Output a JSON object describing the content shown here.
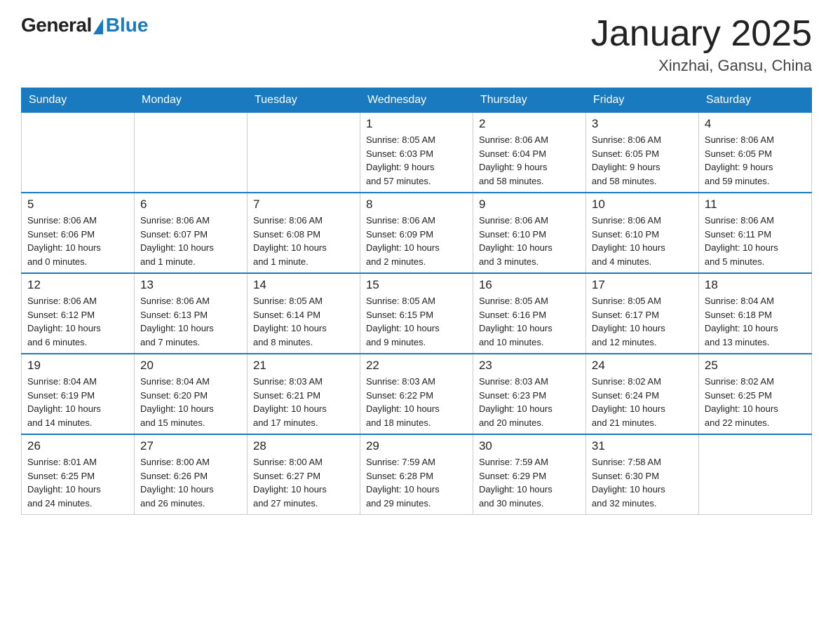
{
  "logo": {
    "general": "General",
    "blue": "Blue"
  },
  "title": "January 2025",
  "subtitle": "Xinzhai, Gansu, China",
  "days_of_week": [
    "Sunday",
    "Monday",
    "Tuesday",
    "Wednesday",
    "Thursday",
    "Friday",
    "Saturday"
  ],
  "weeks": [
    [
      {
        "day": "",
        "info": ""
      },
      {
        "day": "",
        "info": ""
      },
      {
        "day": "",
        "info": ""
      },
      {
        "day": "1",
        "info": "Sunrise: 8:05 AM\nSunset: 6:03 PM\nDaylight: 9 hours\nand 57 minutes."
      },
      {
        "day": "2",
        "info": "Sunrise: 8:06 AM\nSunset: 6:04 PM\nDaylight: 9 hours\nand 58 minutes."
      },
      {
        "day": "3",
        "info": "Sunrise: 8:06 AM\nSunset: 6:05 PM\nDaylight: 9 hours\nand 58 minutes."
      },
      {
        "day": "4",
        "info": "Sunrise: 8:06 AM\nSunset: 6:05 PM\nDaylight: 9 hours\nand 59 minutes."
      }
    ],
    [
      {
        "day": "5",
        "info": "Sunrise: 8:06 AM\nSunset: 6:06 PM\nDaylight: 10 hours\nand 0 minutes."
      },
      {
        "day": "6",
        "info": "Sunrise: 8:06 AM\nSunset: 6:07 PM\nDaylight: 10 hours\nand 1 minute."
      },
      {
        "day": "7",
        "info": "Sunrise: 8:06 AM\nSunset: 6:08 PM\nDaylight: 10 hours\nand 1 minute."
      },
      {
        "day": "8",
        "info": "Sunrise: 8:06 AM\nSunset: 6:09 PM\nDaylight: 10 hours\nand 2 minutes."
      },
      {
        "day": "9",
        "info": "Sunrise: 8:06 AM\nSunset: 6:10 PM\nDaylight: 10 hours\nand 3 minutes."
      },
      {
        "day": "10",
        "info": "Sunrise: 8:06 AM\nSunset: 6:10 PM\nDaylight: 10 hours\nand 4 minutes."
      },
      {
        "day": "11",
        "info": "Sunrise: 8:06 AM\nSunset: 6:11 PM\nDaylight: 10 hours\nand 5 minutes."
      }
    ],
    [
      {
        "day": "12",
        "info": "Sunrise: 8:06 AM\nSunset: 6:12 PM\nDaylight: 10 hours\nand 6 minutes."
      },
      {
        "day": "13",
        "info": "Sunrise: 8:06 AM\nSunset: 6:13 PM\nDaylight: 10 hours\nand 7 minutes."
      },
      {
        "day": "14",
        "info": "Sunrise: 8:05 AM\nSunset: 6:14 PM\nDaylight: 10 hours\nand 8 minutes."
      },
      {
        "day": "15",
        "info": "Sunrise: 8:05 AM\nSunset: 6:15 PM\nDaylight: 10 hours\nand 9 minutes."
      },
      {
        "day": "16",
        "info": "Sunrise: 8:05 AM\nSunset: 6:16 PM\nDaylight: 10 hours\nand 10 minutes."
      },
      {
        "day": "17",
        "info": "Sunrise: 8:05 AM\nSunset: 6:17 PM\nDaylight: 10 hours\nand 12 minutes."
      },
      {
        "day": "18",
        "info": "Sunrise: 8:04 AM\nSunset: 6:18 PM\nDaylight: 10 hours\nand 13 minutes."
      }
    ],
    [
      {
        "day": "19",
        "info": "Sunrise: 8:04 AM\nSunset: 6:19 PM\nDaylight: 10 hours\nand 14 minutes."
      },
      {
        "day": "20",
        "info": "Sunrise: 8:04 AM\nSunset: 6:20 PM\nDaylight: 10 hours\nand 15 minutes."
      },
      {
        "day": "21",
        "info": "Sunrise: 8:03 AM\nSunset: 6:21 PM\nDaylight: 10 hours\nand 17 minutes."
      },
      {
        "day": "22",
        "info": "Sunrise: 8:03 AM\nSunset: 6:22 PM\nDaylight: 10 hours\nand 18 minutes."
      },
      {
        "day": "23",
        "info": "Sunrise: 8:03 AM\nSunset: 6:23 PM\nDaylight: 10 hours\nand 20 minutes."
      },
      {
        "day": "24",
        "info": "Sunrise: 8:02 AM\nSunset: 6:24 PM\nDaylight: 10 hours\nand 21 minutes."
      },
      {
        "day": "25",
        "info": "Sunrise: 8:02 AM\nSunset: 6:25 PM\nDaylight: 10 hours\nand 22 minutes."
      }
    ],
    [
      {
        "day": "26",
        "info": "Sunrise: 8:01 AM\nSunset: 6:25 PM\nDaylight: 10 hours\nand 24 minutes."
      },
      {
        "day": "27",
        "info": "Sunrise: 8:00 AM\nSunset: 6:26 PM\nDaylight: 10 hours\nand 26 minutes."
      },
      {
        "day": "28",
        "info": "Sunrise: 8:00 AM\nSunset: 6:27 PM\nDaylight: 10 hours\nand 27 minutes."
      },
      {
        "day": "29",
        "info": "Sunrise: 7:59 AM\nSunset: 6:28 PM\nDaylight: 10 hours\nand 29 minutes."
      },
      {
        "day": "30",
        "info": "Sunrise: 7:59 AM\nSunset: 6:29 PM\nDaylight: 10 hours\nand 30 minutes."
      },
      {
        "day": "31",
        "info": "Sunrise: 7:58 AM\nSunset: 6:30 PM\nDaylight: 10 hours\nand 32 minutes."
      },
      {
        "day": "",
        "info": ""
      }
    ]
  ]
}
